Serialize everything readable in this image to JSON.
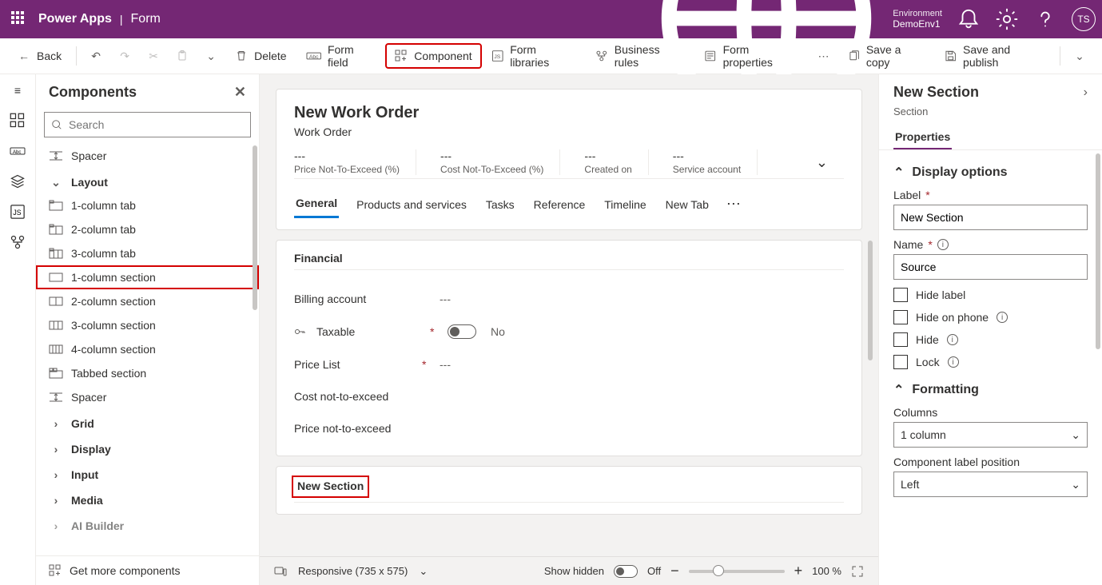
{
  "topbar": {
    "app": "Power Apps",
    "page": "Form",
    "env_label": "Environment",
    "env_name": "DemoEnv1",
    "avatar": "TS"
  },
  "cmd": {
    "back": "Back",
    "delete": "Delete",
    "formfield": "Form field",
    "component": "Component",
    "libraries": "Form libraries",
    "rules": "Business rules",
    "properties": "Form properties",
    "savecopy": "Save a copy",
    "savepublish": "Save and publish"
  },
  "panel": {
    "title": "Components",
    "search_placeholder": "Search",
    "groups": {
      "spacer_top": "Spacer",
      "layout": "Layout",
      "items": [
        "1-column tab",
        "2-column tab",
        "3-column tab",
        "1-column section",
        "2-column section",
        "3-column section",
        "4-column section",
        "Tabbed section",
        "Spacer"
      ],
      "grid": "Grid",
      "display": "Display",
      "input": "Input",
      "media": "Media",
      "ai": "AI Builder"
    },
    "footer": "Get more components"
  },
  "form": {
    "title": "New Work Order",
    "subtitle": "Work Order",
    "header_cols": [
      {
        "value": "---",
        "label": "Price Not-To-Exceed (%)"
      },
      {
        "value": "---",
        "label": "Cost Not-To-Exceed (%)"
      },
      {
        "value": "---",
        "label": "Created on"
      },
      {
        "value": "---",
        "label": "Service account"
      }
    ],
    "tabs": [
      "General",
      "Products and services",
      "Tasks",
      "Reference",
      "Timeline",
      "New Tab"
    ],
    "section_financial": {
      "title": "Financial",
      "rows": {
        "billing": {
          "label": "Billing account",
          "value": "---"
        },
        "taxable": {
          "label": "Taxable",
          "value": "No"
        },
        "pricelist": {
          "label": "Price List",
          "value": "---"
        },
        "cost_nte": {
          "label": "Cost not-to-exceed"
        },
        "price_nte": {
          "label": "Price not-to-exceed"
        }
      }
    },
    "section_new": {
      "title": "New Section"
    }
  },
  "status": {
    "responsive": "Responsive (735 x 575)",
    "showhidden": "Show hidden",
    "offlabel": "Off",
    "zoom": "100 %"
  },
  "prop": {
    "title": "New Section",
    "subtitle": "Section",
    "tab": "Properties",
    "display_options": "Display options",
    "label_label": "Label",
    "label_value": "New Section",
    "name_label": "Name",
    "name_value": "Source",
    "hide_label": "Hide label",
    "hide_phone": "Hide on phone",
    "hide": "Hide",
    "lock": "Lock",
    "formatting": "Formatting",
    "columns_label": "Columns",
    "columns_value": "1 column",
    "clp": "Component label position",
    "clp_value": "Left"
  }
}
